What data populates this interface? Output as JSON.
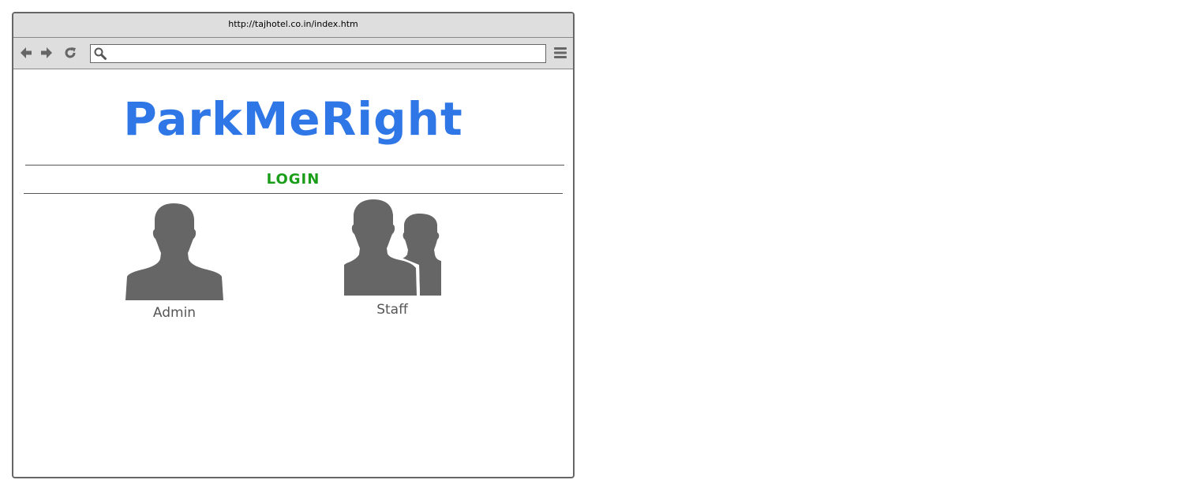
{
  "browser": {
    "url": "http://tajhotel.co.in/index.htm",
    "address_value": "",
    "address_placeholder": ""
  },
  "page": {
    "logo": "ParkMeRight",
    "login_title": "LOGIN",
    "roles": [
      {
        "label": "Admin",
        "icon": "user-icon"
      },
      {
        "label": "Staff",
        "icon": "users-icon"
      }
    ]
  },
  "colors": {
    "logo": "#2f77e6",
    "login": "#1a9e1a",
    "icon": "#666666",
    "chrome": "#dedede"
  }
}
